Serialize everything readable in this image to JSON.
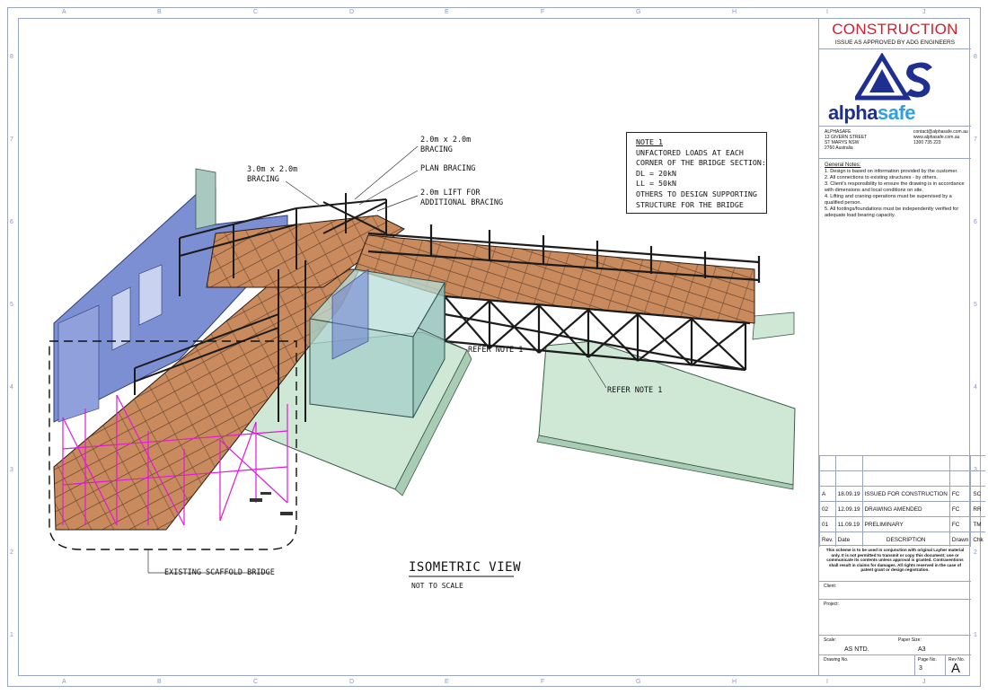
{
  "zones": {
    "letters": [
      "A",
      "B",
      "C",
      "D",
      "E",
      "F",
      "G",
      "H",
      "I",
      "J"
    ],
    "numbers": [
      "8",
      "7",
      "6",
      "5",
      "4",
      "3",
      "2",
      "1"
    ]
  },
  "drawing": {
    "view_title": "ISOMETRIC VIEW",
    "view_subtitle": "NOT TO SCALE",
    "callouts": {
      "bracing_3x2_line1": "3.0m x 2.0m",
      "bracing_3x2_line2": "BRACING",
      "bracing_2x2_line1": "2.0m x 2.0m",
      "bracing_2x2_line2": "BRACING",
      "plan_bracing": "PLAN BRACING",
      "lift_line1": "2.0m LIFT FOR",
      "lift_line2": "ADDITIONAL BRACING",
      "refer_note_1a": "REFER NOTE 1",
      "refer_note_1b": "REFER NOTE 1",
      "existing_bridge": "EXISTING SCAFFOLD BRIDGE"
    },
    "note_box": {
      "title": "NOTE 1",
      "lines": [
        "UNFACTORED LOADS AT EACH",
        "CORNER OF THE BRIDGE SECTION:",
        "DL = 20kN",
        "LL = 50kN",
        "OTHERS TO DESIGN SUPPORTING",
        "STRUCTURE FOR THE BRIDGE"
      ]
    }
  },
  "title_block": {
    "status": "CONSTRUCTION",
    "status_sub": "ISSUE AS APPROVED BY ADG ENGINEERS",
    "logo_mark": "AS",
    "logo_word_a": "alpha",
    "logo_word_b": "safe",
    "company": {
      "name": "ALPHASAFE",
      "addr1": "13 GIVERN STREET",
      "addr2": "ST MARYS NSW",
      "addr3": "2760 Australia",
      "email": "contact@alphasafe.com.au",
      "web": "www.alphasafe.com.au",
      "phone": "1300 735 223"
    },
    "general_notes_title": "General Notes:",
    "general_notes": [
      "1. Design is based on information provided by the customer.",
      "2. All connections to existing structures - by others.",
      "3. Client's responsibility to ensure the drawing is in accordance with dimensions and local conditions on site.",
      "4. Lifting and craning operations must be supervised by a qualified person.",
      "5. All footings/foundations must be independently verified for adequate load bearing capacity."
    ],
    "revisions": [
      {
        "rev": "A",
        "date": "18.09.19",
        "desc": "ISSUED FOR CONSTRUCTION",
        "drawn": "FC",
        "chk": "SC"
      },
      {
        "rev": "02",
        "date": "12.09.19",
        "desc": "DRAWING AMENDED",
        "drawn": "FC",
        "chk": "RR"
      },
      {
        "rev": "01",
        "date": "11.09.19",
        "desc": "PRELIMINARY",
        "drawn": "FC",
        "chk": "TM"
      }
    ],
    "rev_headers": {
      "rev": "Rev.",
      "date": "Date",
      "desc": "DESCRIPTION",
      "drawn": "Drawn",
      "chk": "Chk"
    },
    "disclaimer": "This scheme is to be used in conjunction with original Layher material only. It is not permitted to transmit or copy this document; use or communicate its contents unless approval is granted. Contraventions shall result in claims for damages. All rights reserved in the case of patent grant or design registration.",
    "client_label": "Client:",
    "project_label": "Project:",
    "scale_label": "Scale:",
    "scale_value": "AS NTD.",
    "paper_label": "Paper Size:",
    "paper_value": "A3",
    "drawing_no_label": "Drawing No.",
    "page_label": "Page No.",
    "page_value": "3",
    "revno_label": "Rev No.",
    "revno_value": "A"
  }
}
